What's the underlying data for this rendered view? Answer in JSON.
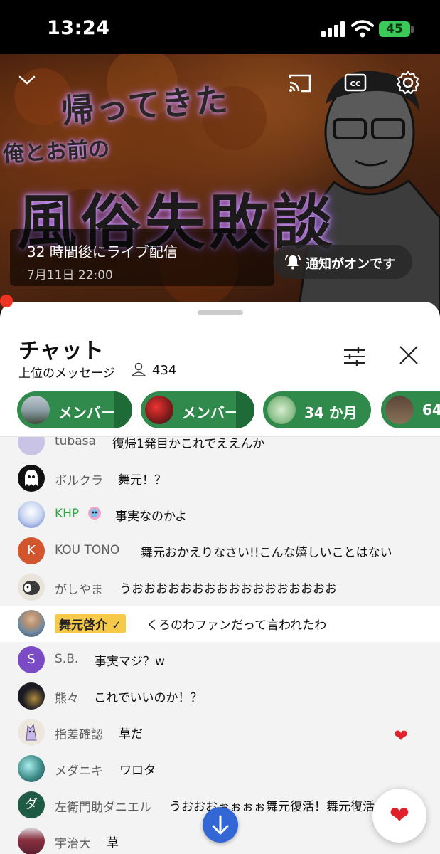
{
  "status_bar": {
    "time": "13:24",
    "battery": "45"
  },
  "video": {
    "title_line1": "帰ってきた",
    "title_line2": "俺とお前の",
    "title_line3": "風俗失敗談",
    "live_title": "32 時間後にライブ配信",
    "live_date": "7月11日 22:00",
    "notify_label": "通知がオンです"
  },
  "chat": {
    "title": "チャット",
    "mode": "上位のメッセージ",
    "viewer_count": "434",
    "chips": [
      {
        "label": "メンバー"
      },
      {
        "label": "メンバー"
      },
      {
        "label": "34 か月"
      },
      {
        "label": "64"
      }
    ],
    "messages": [
      {
        "author": "tubasa",
        "text": "復帰1発目かこれでええんか",
        "avatar_color": "#c9c3e6"
      },
      {
        "author": "ボルクラ",
        "text": "舞元！？",
        "avatar_color": "#111111"
      },
      {
        "author": "KHP",
        "text": "事実なのかよ",
        "avatar_color": "#5a72c8"
      },
      {
        "author": "KOU TONO",
        "text": "舞元おかえりなさい!!こんな嬉しいことはない",
        "avatar_color": "#d2552e",
        "avatar_letter": "K"
      },
      {
        "author": "がしやま",
        "text": "うおおおおおおおおおおおおおおおおお",
        "avatar_color": "#3a3a3a"
      },
      {
        "author": "舞元啓介",
        "text": "くろのわファンだって言われたわ",
        "avatar_color": "#6f8aa0"
      },
      {
        "author": "S.B.",
        "text": "事実マジ？w",
        "avatar_color": "#7a4bc4",
        "avatar_letter": "S"
      },
      {
        "author": "熊々",
        "text": "これでいいのか！？",
        "avatar_color": "#1b1b24"
      },
      {
        "author": "指差確認",
        "text": "草だ",
        "avatar_color": "#e8e0d8"
      },
      {
        "author": "メダニキ",
        "text": "ワロタ",
        "avatar_color": "#3f8c8a"
      },
      {
        "author": "左衛門助ダニエル",
        "text": "うおおおぉぉぉぉ舞元復活！舞元復活",
        "avatar_color": "#1e5a44",
        "avatar_letter": "ダ"
      },
      {
        "author": "宇治大",
        "text": "草",
        "avatar_color": "#8a3040"
      }
    ]
  }
}
